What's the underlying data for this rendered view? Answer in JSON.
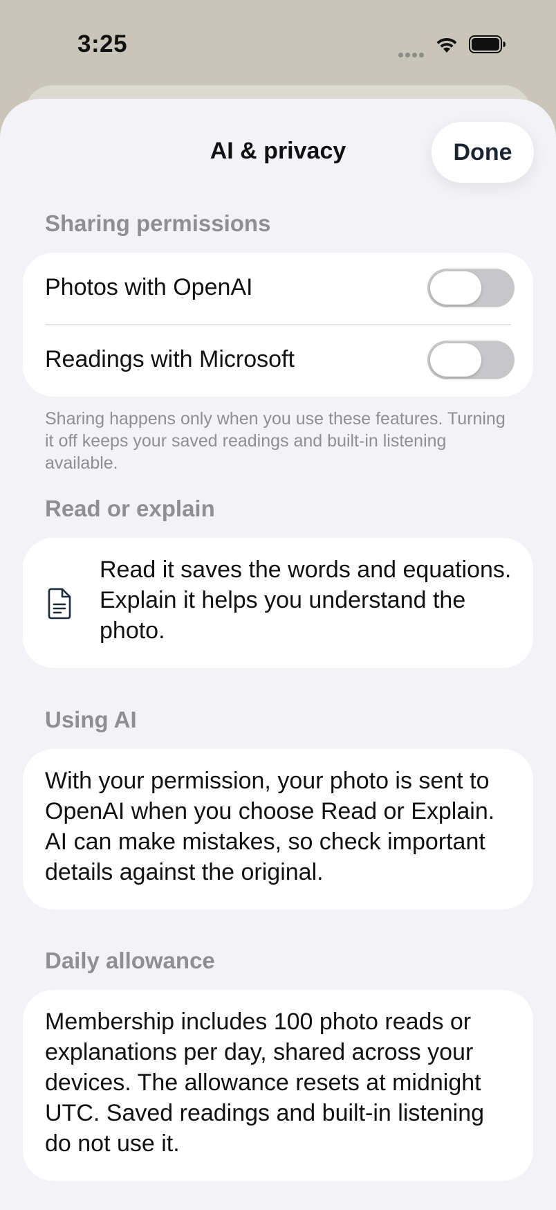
{
  "status_bar": {
    "time": "3:25"
  },
  "header": {
    "title": "AI & privacy",
    "done_label": "Done"
  },
  "sharing": {
    "header": "Sharing permissions",
    "rows": [
      {
        "label": "Photos with OpenAI",
        "enabled": false
      },
      {
        "label": "Readings with Microsoft",
        "enabled": false
      }
    ],
    "footnote": "Sharing happens only when you use these features. Turning it off keeps your saved readings and built-in listening available."
  },
  "read_explain": {
    "header": "Read or explain",
    "icon": "document-icon",
    "text": "Read it saves the words and equations. Explain it helps you understand the photo."
  },
  "using_ai": {
    "header": "Using AI",
    "text": "With your permission, your photo is sent to OpenAI when you choose Read or Explain. AI can make mistakes, so check important details against the original."
  },
  "allowance": {
    "header": "Daily allowance",
    "text": "Membership includes 100 photo reads or explanations per day, shared across your devices. The allowance resets at midnight UTC. Saved readings and built-in listening do not use it."
  },
  "colors": {
    "sheet_background": "#f2f2f7",
    "card_background": "#ffffff",
    "secondary_text": "#8e8e93",
    "toggle_off": "#c7c7c9"
  }
}
